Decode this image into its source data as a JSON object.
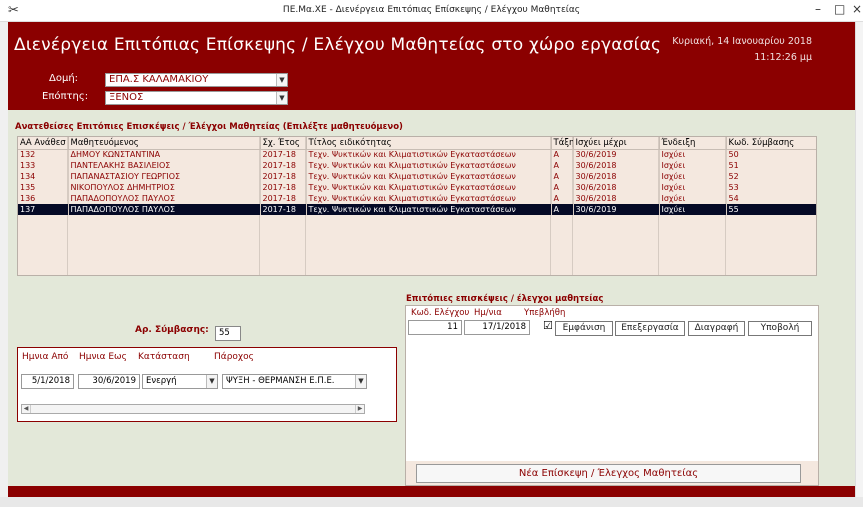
{
  "window": {
    "title": "ΠΕ.Μα.ΧΕ - Διενέργεια Επιτόπιας Επίσκεψης / Ελέγχου Μαθητείας",
    "minimize_glyph": "–",
    "maximize_glyph": "□",
    "close_glyph": "×",
    "app_icon": "tools-icon"
  },
  "header": {
    "heading": "Διενέργεια Επιτόπιας Επίσκεψης  / Ελέγχου  Μαθητείας στο χώρο εργασίας",
    "date": "Κυριακή, 14 Ιανουαρίου 2018",
    "time": "11:12:26 μμ",
    "domi_label": "Δομή:",
    "domi_value": "ΕΠΑ.Σ ΚΑΛΑΜΑΚΙΟΥ",
    "epoptis_label": "Επόπτης:",
    "epoptis_value": "ΞΕΝΟΣ"
  },
  "assignments": {
    "section_label": "Ανατεθείσες Επιτόπιες Επισκέψεις / Έλέγχοι Μαθητείας (Επιλέξτε μαθητευόμενο)",
    "columns": [
      "ΑΑ Ανάθεσ",
      "Μαθητευόμενος",
      "Σχ. Έτος",
      "Τίτλος ειδικότητας",
      "Τάξη",
      "Ισχύει μέχρι",
      "Ένδειξη",
      "Κωδ. Σύμβασης"
    ],
    "rows": [
      [
        "132",
        "ΔΗΜΟΥ ΚΩΝΣΤΑΝΤΙΝΑ",
        "2017-18",
        "Τεχν. Ψυκτικών και Κλιματιστικών Εγκαταστάσεων",
        "Α",
        "30/6/2019",
        "Ισχύει",
        "50"
      ],
      [
        "133",
        "ΠΑΝΤΕΛΑΚΗΣ ΒΑΣΙΛΕΙΟΣ",
        "2017-18",
        "Τεχν. Ψυκτικών και Κλιματιστικών Εγκαταστάσεων",
        "Α",
        "30/6/2018",
        "Ισχύει",
        "51"
      ],
      [
        "134",
        "ΠΑΠΑΝΑΣΤΑΣΙΟΥ ΓΕΩΡΓΙΟΣ",
        "2017-18",
        "Τεχν. Ψυκτικών και Κλιματιστικών Εγκαταστάσεων",
        "Α",
        "30/6/2018",
        "Ισχύει",
        "52"
      ],
      [
        "135",
        "ΝΙΚΟΠΟΥΛΟΣ ΔΗΜΗΤΡΙΟΣ",
        "2017-18",
        "Τεχν. Ψυκτικών και Κλιματιστικών Εγκαταστάσεων",
        "Α",
        "30/6/2018",
        "Ισχύει",
        "53"
      ],
      [
        "136",
        "ΠΑΠΑΔΟΠΟΥΛΟΣ ΠΑΥΛΟΣ",
        "2017-18",
        "Τεχν. Ψυκτικών και Κλιματιστικών Εγκαταστάσεων",
        "Α",
        "30/6/2018",
        "Ισχύει",
        "54"
      ],
      [
        "137",
        "ΠΑΠΑΔΟΠΟΥΛΟΣ ΠΑΥΛΟΣ",
        "2017-18",
        "Τεχν. Ψυκτικών και Κλιματιστικών Εγκαταστάσεων",
        "Α",
        "30/6/2019",
        "Ισχύει",
        "55"
      ]
    ],
    "selected_index": 5
  },
  "contract": {
    "label": "Αρ. Σύμβασης:",
    "value": "55",
    "col_from": "Ημνια Από",
    "col_to": "Ημνια Εως",
    "col_status": "Κατάσταση",
    "col_provider": "Πάροχος",
    "from": "5/1/2018",
    "to": "30/6/2019",
    "status": "Ενεργή",
    "provider": "ΨΥΞΗ - ΘΕΡΜΑΝΣΗ Ε.Π.Ε."
  },
  "visits": {
    "section_label": "Επιτόπιες επισκέψεις / έλεγχοι μαθητείας",
    "col_code": "Κωδ. Ελέγχου",
    "col_date": "Ημ/νια",
    "col_submitted": "Υπεβλήθη",
    "code": "11",
    "date": "17/1/2018",
    "submitted_mark": "☑",
    "btn_view": "Εμφάνιση",
    "btn_edit": "Επεξεργασία",
    "btn_delete": "Διαγραφή",
    "btn_submit": "Υποβολή",
    "btn_new": "Νέα Επίσκεψη /  Έλεγχος Μαθητείας"
  },
  "colors": {
    "brand": "#8b0000",
    "panel": "#e3e8d9",
    "selection": "#050a26"
  }
}
